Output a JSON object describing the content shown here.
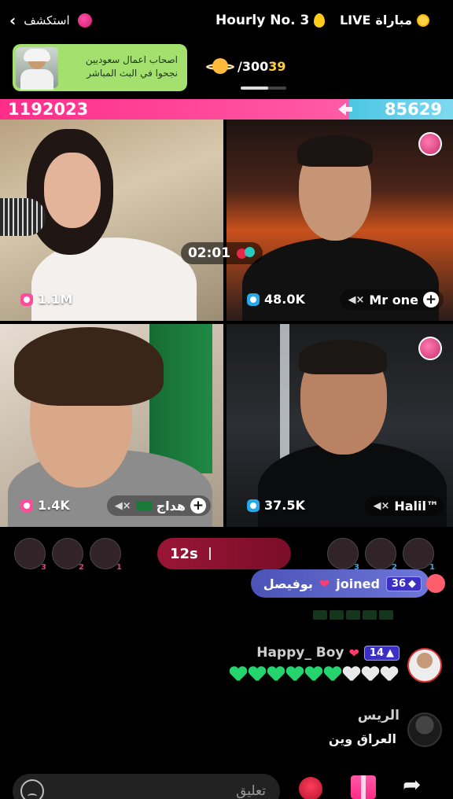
{
  "topbar": {
    "explore_label": "استكشف",
    "hourly_label": "Hourly No. 3",
    "live_label": "LIVE",
    "match_label": "مباراة"
  },
  "ad_banner": {
    "line1": "اصحاب اعمال سعوديين",
    "line2": "نجحوا في البث المباشر"
  },
  "level": {
    "current": "39",
    "total": "/300",
    "progress_fraction": 0.6
  },
  "pk": {
    "left_score": "1192023",
    "right_score": "85629",
    "left_share": 0.77
  },
  "timer": "02:01",
  "tiles": [
    {
      "likes": "1.1M",
      "name": ""
    },
    {
      "likes": "48.0K",
      "name": "Mr one"
    },
    {
      "likes": "1.4K",
      "name": "هداج"
    },
    {
      "likes": "37.5K",
      "name": "Halil™"
    }
  ],
  "battle": {
    "countdown": "12s",
    "left_ranks": [
      "3",
      "2",
      "1"
    ],
    "right_ranks": [
      "3",
      "2",
      "1"
    ]
  },
  "chat": {
    "join_user": "بوفيصل",
    "join_text": "joined",
    "join_level": "36",
    "msg1_user": "Happy_ Boy",
    "msg1_level": "14",
    "msg2_user": "الريس",
    "msg2_text": "العراق وين"
  },
  "bottom": {
    "comment_placeholder": "تعليق"
  },
  "colors": {
    "pk_pink": "#ff2d8a",
    "pk_blue": "#4cc6e3",
    "countdown_bg": "#9a1536",
    "joined_pill": "#4b53b8"
  }
}
